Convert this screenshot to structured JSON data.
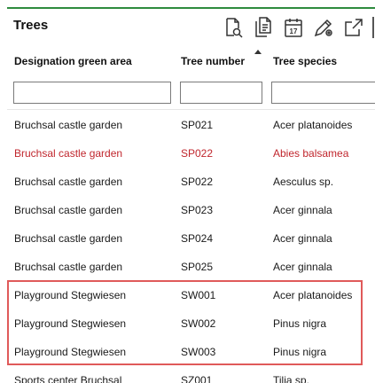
{
  "panel": {
    "title": "Trees"
  },
  "toolbar": {
    "buttons": [
      {
        "icon": "document-search-icon"
      },
      {
        "icon": "documents-copy-icon"
      },
      {
        "icon": "calendar-icon",
        "day": "17"
      },
      {
        "icon": "pencil-settings-icon"
      },
      {
        "icon": "export-icon"
      }
    ]
  },
  "table": {
    "columns": [
      {
        "label": "Designation green area"
      },
      {
        "label": "Tree number",
        "sorted": "ascending"
      },
      {
        "label": "Tree species"
      }
    ],
    "filters": {
      "designation": "",
      "number": "",
      "species": ""
    },
    "rows": [
      {
        "designation": "Bruchsal castle garden",
        "number": "SP021",
        "species": "Acer platanoides"
      },
      {
        "designation": "Bruchsal castle garden",
        "number": "SP022",
        "species": "Abies balsamea",
        "color": "#c0262d"
      },
      {
        "designation": "Bruchsal castle garden",
        "number": "SP022",
        "species": "Aesculus sp."
      },
      {
        "designation": "Bruchsal castle garden",
        "number": "SP023",
        "species": "Acer ginnala"
      },
      {
        "designation": "Bruchsal castle garden",
        "number": "SP024",
        "species": "Acer ginnala"
      },
      {
        "designation": "Bruchsal castle garden",
        "number": "SP025",
        "species": "Acer ginnala"
      },
      {
        "designation": "Playground Stegwiesen",
        "number": "SW001",
        "species": "Acer platanoides"
      },
      {
        "designation": "Playground Stegwiesen",
        "number": "SW002",
        "species": "Pinus nigra"
      },
      {
        "designation": "Playground Stegwiesen",
        "number": "SW003",
        "species": "Pinus nigra"
      },
      {
        "designation": "Sports center Bruchsal",
        "number": "SZ001",
        "species": "Tilia sp."
      }
    ]
  },
  "colors": {
    "accent": "#2e8b3e",
    "highlight_border": "#e05a5a",
    "error_text": "#c0262d"
  }
}
